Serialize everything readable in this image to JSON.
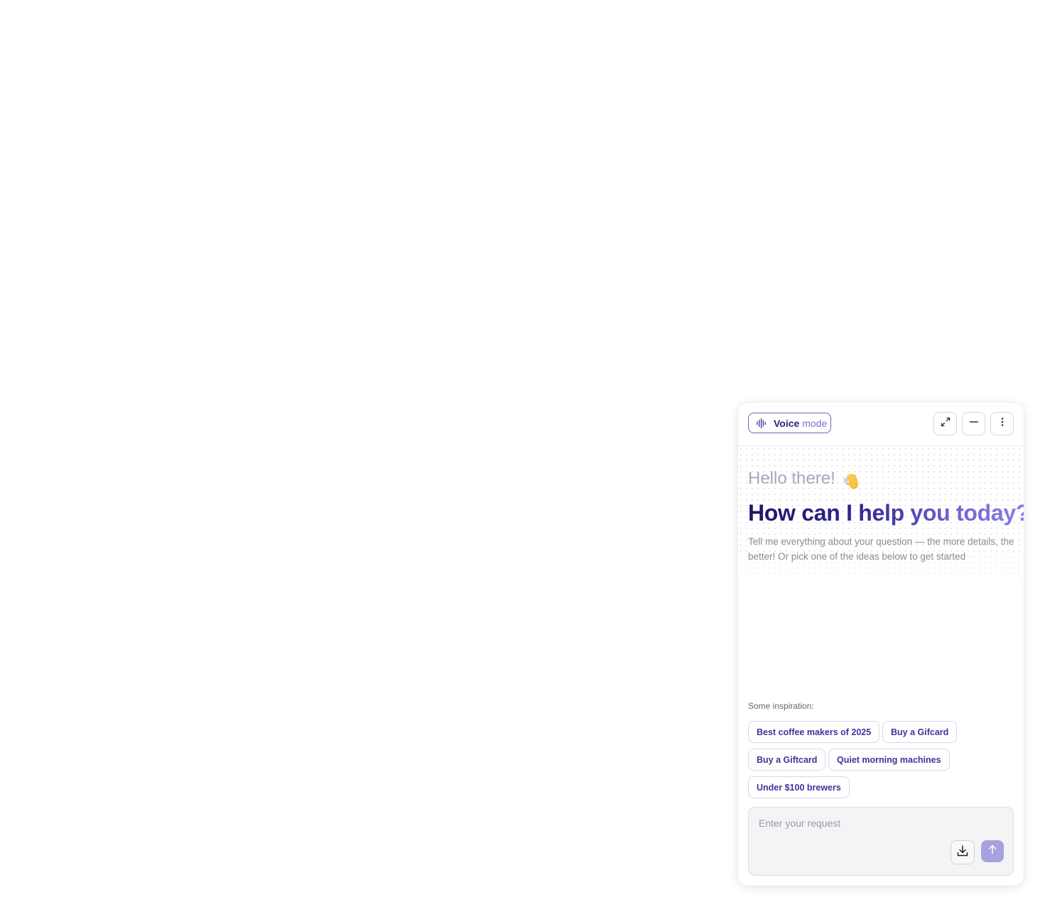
{
  "header": {
    "voice_mode": {
      "label_strong": "Voice",
      "label_light": "mode",
      "icon": "soundwave-icon"
    },
    "buttons": [
      {
        "name": "expand-button",
        "icon": "expand-icon"
      },
      {
        "name": "minimize-button",
        "icon": "minus-icon"
      },
      {
        "name": "more-options-button",
        "icon": "vertical-dots-icon"
      }
    ]
  },
  "welcome": {
    "greeting": "Hello there!",
    "greeting_emoji": "waving-hand-icon",
    "headline": "How can I help you today?",
    "subtitle": "Tell me everything about your question — the more details, the better! Or pick one of the ideas below to get started"
  },
  "inspiration": {
    "label": "Some inspiration:",
    "chips": [
      "Best coffee makers of 2025",
      "Buy a Gifcard",
      "Buy a Giftcard",
      "Quiet morning machines",
      "Under $100 brewers"
    ]
  },
  "composer": {
    "placeholder": "Enter your request",
    "value": "",
    "attach_icon": "download-icon",
    "send_icon": "arrow-up-icon"
  },
  "colors": {
    "accent": "#3d3599",
    "accent_dark": "#1d1567",
    "accent_light": "#8b82e6",
    "send_button": "#a7a1e0"
  }
}
